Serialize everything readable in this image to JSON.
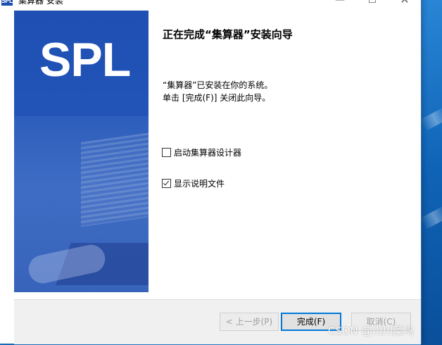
{
  "window": {
    "title": "集算器 安装",
    "logo_text": "SPL",
    "minimize_icon": "minimize-icon",
    "maximize_icon": "maximize-icon",
    "close_icon": "close-icon"
  },
  "sidebar": {
    "logo": "SPL"
  },
  "content": {
    "heading": "正在完成“集算器”安装向导",
    "line1": "“集算器”已安装在你的系统。",
    "line2": "单击 [完成(F)] 关闭此向导。",
    "options": [
      {
        "label": "启动集算器设计器",
        "checked": false
      },
      {
        "label": "显示说明文件",
        "checked": true
      }
    ]
  },
  "buttons": {
    "back": "< 上一步(P)",
    "finish": "完成(F)",
    "cancel": "取消(C)"
  },
  "watermark": "CSDN @川川菜鸟",
  "colors": {
    "sidebar_blue": "#2255b8",
    "focus_border": "#0078d7",
    "desktop_blue": "#0f63b6"
  }
}
